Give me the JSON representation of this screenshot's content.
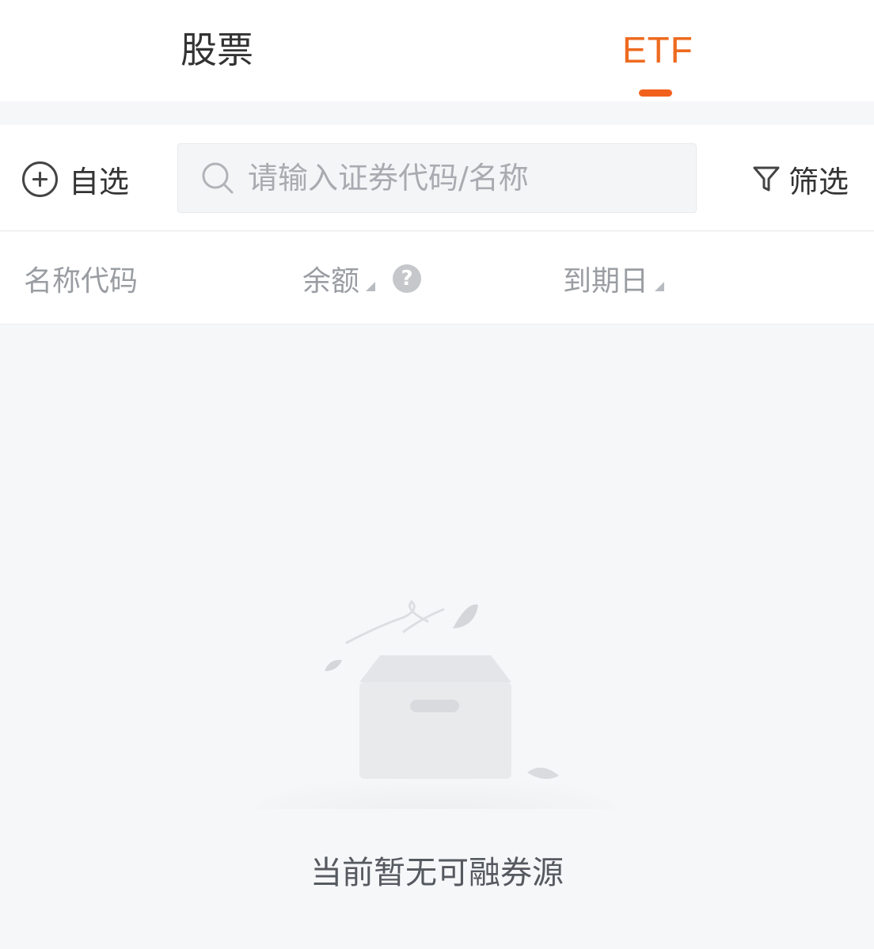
{
  "tabs": [
    {
      "label": "股票",
      "active": false
    },
    {
      "label": "ETF",
      "active": true
    }
  ],
  "accent_color": "#f2611c",
  "toolbar": {
    "watchlist_label": "自选",
    "search_placeholder": "请输入证券代码/名称",
    "filter_label": "筛选"
  },
  "columns": {
    "name_code": "名称代码",
    "balance": "余额",
    "expiry": "到期日"
  },
  "empty_state": {
    "message": "当前暂无可融券源",
    "icon": "empty-box-icon"
  }
}
